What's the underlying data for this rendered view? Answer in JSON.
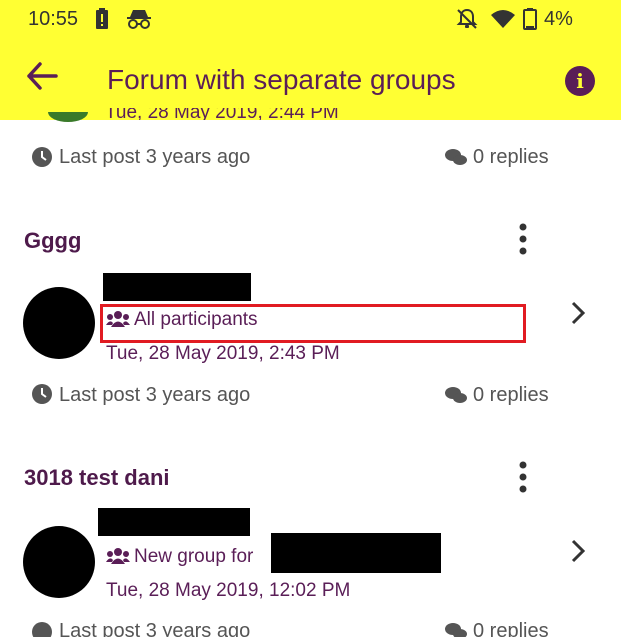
{
  "status_bar": {
    "time": "10:55",
    "battery_pct": "4%"
  },
  "app_bar": {
    "title": "Forum with separate groups"
  },
  "partial_top": {
    "date": "Tue, 28 May 2019, 2:44 PM",
    "last_post": "Last post 3 years ago",
    "replies": "0 replies"
  },
  "discussions": [
    {
      "title": "Gggg",
      "group": "All participants",
      "date": "Tue, 28 May 2019, 2:43 PM",
      "last_post": "Last post 3 years ago",
      "replies": "0 replies"
    },
    {
      "title": "3018 test dani",
      "group": "New group for",
      "date": "Tue, 28 May 2019, 12:02 PM",
      "last_post": "Last post 3 years ago",
      "replies": "0 replies"
    }
  ],
  "colors": {
    "app_bar_bg": "#ffff33",
    "accent": "#5a1e57",
    "highlight_box": "#e11b22"
  }
}
